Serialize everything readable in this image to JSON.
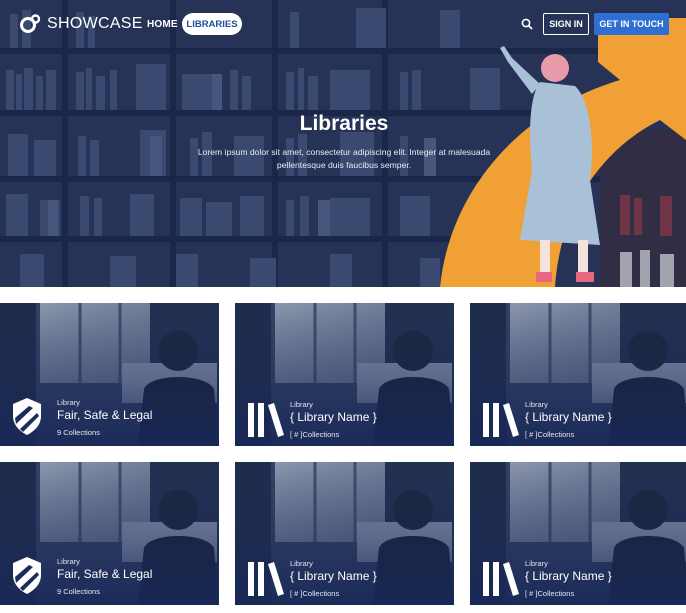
{
  "nav": {
    "logo_text": "SHOWCASE",
    "home": "HOME",
    "libraries": "LIBRARIES",
    "sign_in": "SIGN IN",
    "get_in_touch": "GET IN TOUCH",
    "search_icon": "search-icon"
  },
  "hero": {
    "title": "Libraries",
    "subtitle": "Lorem ipsum dolor sit amet, consectetur adipiscing elit. Integer at malesuada pellentesque duis faucibus semper."
  },
  "colors": {
    "accent_orange": "#f0a035",
    "button_blue": "#2f6fd3",
    "card_navy": "#1c2d5a"
  },
  "cards": [
    {
      "kind": "Library",
      "name": "Fair, Safe & Legal",
      "collections": "9 Collections",
      "icon": "shield-icon"
    },
    {
      "kind": "Library",
      "name": "{ Library Name }",
      "collections": "[ # ]Collections",
      "icon": "books-icon"
    },
    {
      "kind": "Library",
      "name": "{ Library Name }",
      "collections": "[ # ]Collections",
      "icon": "books-icon"
    },
    {
      "kind": "Library",
      "name": "Fair, Safe & Legal",
      "collections": "9 Collections",
      "icon": "shield-icon"
    },
    {
      "kind": "Library",
      "name": "{ Library Name }",
      "collections": "[ # ]Collections",
      "icon": "books-icon"
    },
    {
      "kind": "Library",
      "name": "{ Library Name }",
      "collections": "[ # ]Collections",
      "icon": "books-icon"
    }
  ]
}
